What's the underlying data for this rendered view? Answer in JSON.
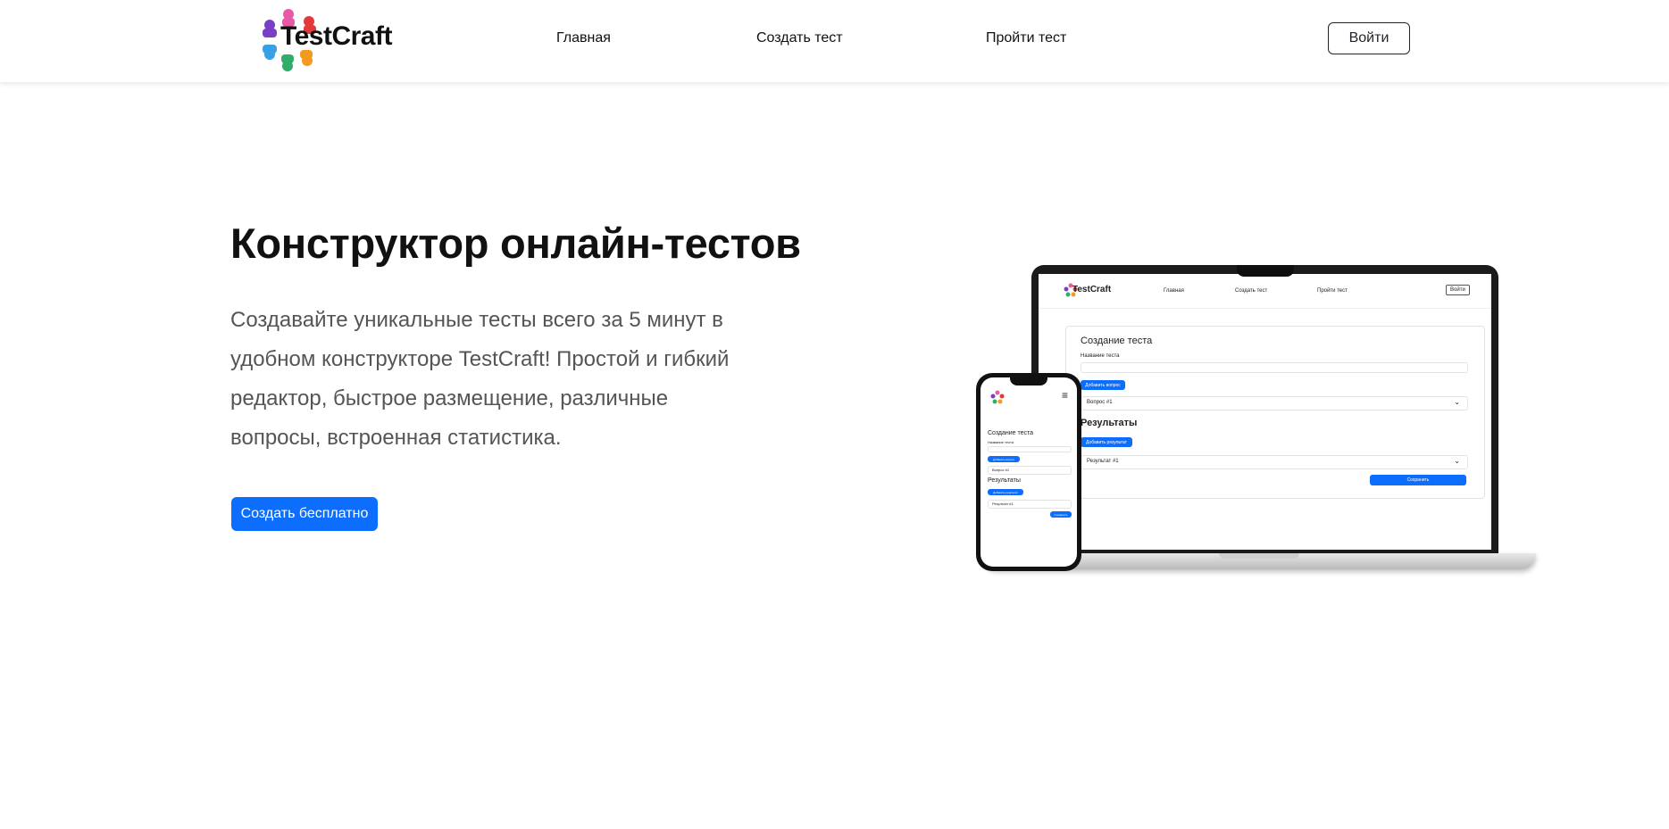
{
  "brand": {
    "name": "TestCraft"
  },
  "nav": {
    "items": [
      {
        "label": "Главная"
      },
      {
        "label": "Создать тест"
      },
      {
        "label": "Пройти тест"
      }
    ],
    "login_label": "Войти"
  },
  "hero": {
    "title": "Конструктор онлайн-тестов",
    "description": "Создавайте уникальные тесты всего за 5 минут в удобном конструкторе TestCraft! Простой и гибкий редактор, быстрое размещение, различные вопросы, встроенная статистика.",
    "cta_label": "Создать бесплатно"
  },
  "mockup": {
    "laptop": {
      "nav_items": [
        "Главная",
        "Создать тест",
        "Пройти тест"
      ],
      "login_label": "Войти",
      "card_title": "Создание теста",
      "name_label": "Название теста",
      "add_question_label": "Добавить вопрос",
      "question_label": "Вопрос #1",
      "results_title": "Результаты",
      "add_result_label": "Добавить результат",
      "result_label": "Результат #1",
      "save_label": "Сохранить"
    },
    "phone": {
      "card_title": "Создание теста",
      "name_label": "Название теста",
      "add_question_label": "Добавить вопрос",
      "question_label": "Вопрос #1",
      "results_title": "Результаты",
      "add_result_label": "Добавить результат",
      "result_label": "Результат #1",
      "save_label": "Сохранить"
    }
  },
  "colors": {
    "primary": "#0d6efd",
    "logo_pink": "#e85aa8",
    "logo_purple": "#7a3fc4",
    "logo_red": "#e23a3a",
    "logo_orange": "#f39a1f",
    "logo_green": "#2fae6b",
    "logo_blue": "#3aa0e6"
  }
}
